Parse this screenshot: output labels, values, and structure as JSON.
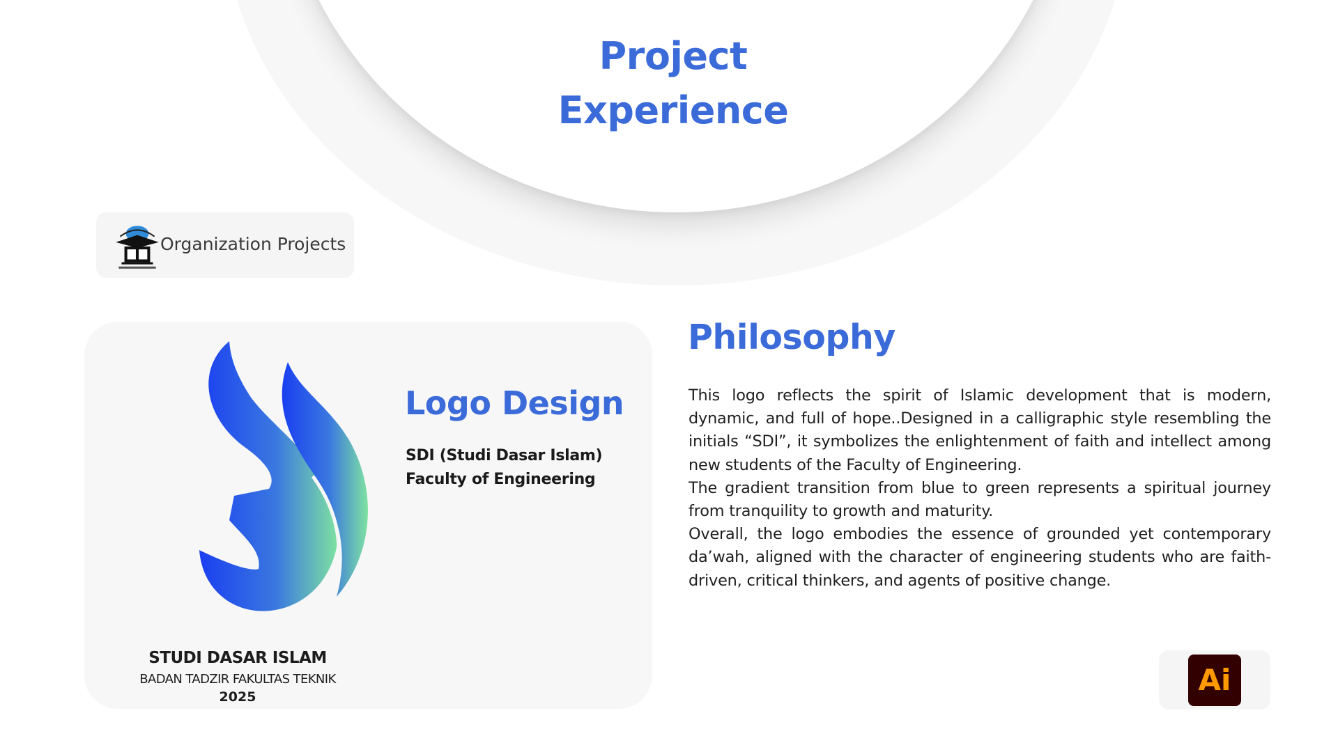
{
  "header": {
    "title_line1": "Project",
    "title_line2": "Experience"
  },
  "organization": {
    "label": "Organization Projects",
    "logo_icon": "organization-emblem-icon"
  },
  "logo_card": {
    "heading": "Logo Design",
    "description": "SDI (Studi Dasar Islam) Faculty of Engineering",
    "brand_title": "STUDI DASAR ISLAM",
    "brand_subtitle": "BADAN TADZIR FAKULTAS TEKNIK",
    "brand_year": "2025",
    "gradient_colors": [
      "#1a3ff0",
      "#3a78e0",
      "#7fe3a0"
    ]
  },
  "philosophy": {
    "heading": "Philosophy",
    "paragraphs": [
      "This logo reflects the spirit of Islamic development that is modern, dynamic, and full of hope..Designed in a calligraphic style resembling the initials “SDI”, it symbolizes the enlightenment of faith and intellect among new students of the Faculty of Engineering.",
      "The gradient transition from blue to green represents a spiritual journey from tranquility to growth and maturity.",
      "Overall, the logo embodies the essence of grounded yet contemporary da’wah, aligned with the character of engineering students who are faith-driven, critical thinkers, and agents of positive change."
    ]
  },
  "tool": {
    "label": "Ai",
    "icon": "adobe-illustrator-icon",
    "icon_bg": "#330000",
    "icon_fg": "#ff9a00"
  },
  "colors": {
    "accent": "#3b6ad9"
  }
}
